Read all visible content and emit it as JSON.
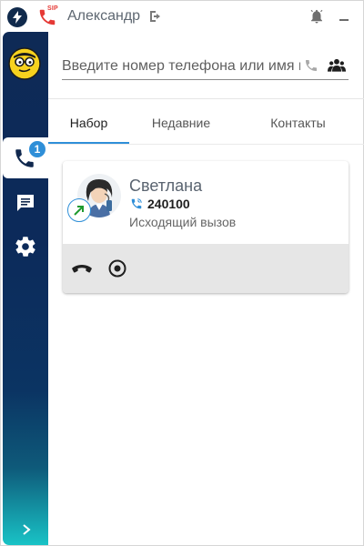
{
  "header": {
    "sip_label": "SIP",
    "username": "Александр"
  },
  "sidebar": {
    "call_badge": "1",
    "items": [
      {
        "name": "calls",
        "icon": "phone-icon",
        "active": true
      },
      {
        "name": "chat",
        "icon": "chat-icon",
        "active": false
      },
      {
        "name": "settings",
        "icon": "gear-icon",
        "active": false
      }
    ]
  },
  "search": {
    "placeholder": "Введите номер телефона или имя контакта",
    "value": ""
  },
  "tabs": [
    {
      "label": "Набор",
      "active": true
    },
    {
      "label": "Недавние",
      "active": false
    },
    {
      "label": "Контакты",
      "active": false
    }
  ],
  "call": {
    "name": "Светлана",
    "number": "240100",
    "status": "Исходящий вызов",
    "direction": "outgoing"
  },
  "colors": {
    "accent": "#2f8fd8",
    "sip_red": "#e53935",
    "sidebar_top": "#0e2a56",
    "sidebar_bottom": "#19c3c6",
    "outgoing_green": "#1e9a2e"
  }
}
